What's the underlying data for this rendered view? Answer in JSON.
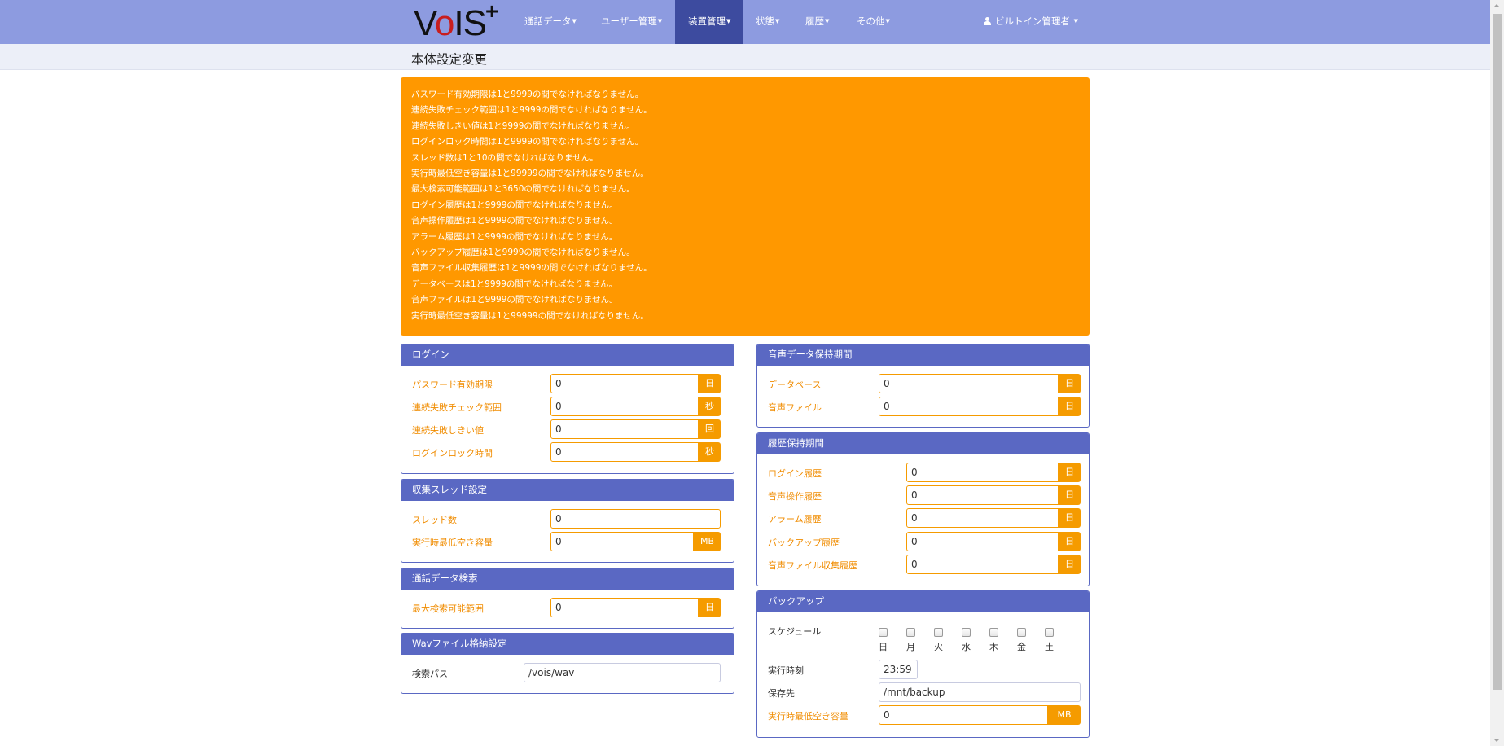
{
  "navbar": {
    "logo": {
      "text_v": "V",
      "text_o": "o",
      "text_is": "IS",
      "plus": "+"
    },
    "items": [
      {
        "label": "通話データ"
      },
      {
        "label": "ユーザー管理"
      },
      {
        "label": "装置管理"
      },
      {
        "label": "状態"
      },
      {
        "label": "履歴"
      },
      {
        "label": "その他"
      }
    ],
    "active_index": 2,
    "user": {
      "label": "ビルトイン管理者"
    }
  },
  "page": {
    "title": "本体設定変更"
  },
  "alert": {
    "messages": [
      "パスワード有効期限は1と9999の間でなければなりません。",
      "連続失敗チェック範囲は1と9999の間でなければなりません。",
      "連続失敗しきい値は1と9999の間でなければなりません。",
      "ログインロック時間は1と9999の間でなければなりません。",
      "スレッド数は1と10の間でなければなりません。",
      "実行時最低空き容量は1と99999の間でなければなりません。",
      "最大検索可能範囲は1と3650の間でなければなりません。",
      "ログイン履歴は1と9999の間でなければなりません。",
      "音声操作履歴は1と9999の間でなければなりません。",
      "アラーム履歴は1と9999の間でなければなりません。",
      "バックアップ履歴は1と9999の間でなければなりません。",
      "音声ファイル収集履歴は1と9999の間でなければなりません。",
      "データベースは1と9999の間でなければなりません。",
      "音声ファイルは1と9999の間でなければなりません。",
      "実行時最低空き容量は1と99999の間でなければなりません。"
    ]
  },
  "login": {
    "title": "ログイン",
    "fields": [
      {
        "label": "パスワード有効期限",
        "value": "0",
        "unit": "日"
      },
      {
        "label": "連続失敗チェック範囲",
        "value": "0",
        "unit": "秒"
      },
      {
        "label": "連続失敗しきい値",
        "value": "0",
        "unit": "回"
      },
      {
        "label": "ログインロック時間",
        "value": "0",
        "unit": "秒"
      }
    ]
  },
  "thread": {
    "title": "収集スレッド設定",
    "fields": [
      {
        "label": "スレッド数",
        "value": "0"
      },
      {
        "label": "実行時最低空き容量",
        "value": "0",
        "unit": "MB"
      }
    ]
  },
  "search": {
    "title": "通話データ検索",
    "fields": [
      {
        "label": "最大検索可能範囲",
        "value": "0",
        "unit": "日"
      }
    ]
  },
  "wav": {
    "title": "Wavファイル格納設定",
    "fields": [
      {
        "label": "検索パス",
        "value": "/vois/wav"
      }
    ]
  },
  "retention": {
    "title": "音声データ保持期間",
    "fields": [
      {
        "label": "データベース",
        "value": "0",
        "unit": "日"
      },
      {
        "label": "音声ファイル",
        "value": "0",
        "unit": "日"
      }
    ]
  },
  "history": {
    "title": "履歴保持期間",
    "fields": [
      {
        "label": "ログイン履歴",
        "value": "0",
        "unit": "日"
      },
      {
        "label": "音声操作履歴",
        "value": "0",
        "unit": "日"
      },
      {
        "label": "アラーム履歴",
        "value": "0",
        "unit": "日"
      },
      {
        "label": "バックアップ履歴",
        "value": "0",
        "unit": "日"
      },
      {
        "label": "音声ファイル収集履歴",
        "value": "0",
        "unit": "日"
      }
    ]
  },
  "backup": {
    "title": "バックアップ",
    "schedule_label": "スケジュール",
    "days": [
      "日",
      "月",
      "火",
      "水",
      "木",
      "金",
      "土"
    ],
    "time_label": "実行時刻",
    "time_value": "23:59",
    "dest_label": "保存先",
    "dest_value": "/mnt/backup",
    "space_label": "実行時最低空き容量",
    "space_value": "0",
    "space_unit": "MB"
  }
}
